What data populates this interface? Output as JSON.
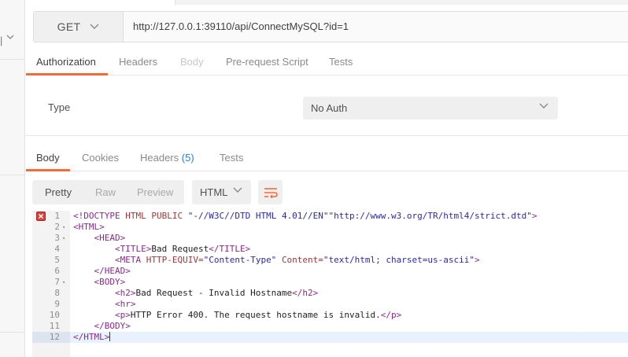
{
  "request": {
    "method": "GET",
    "url": "http://127.0.0.1:39110/api/ConnectMySQL?id=1",
    "tabs": [
      {
        "label": "Authorization",
        "state": "active"
      },
      {
        "label": "Headers",
        "state": "normal"
      },
      {
        "label": "Body",
        "state": "disabled"
      },
      {
        "label": "Pre-request Script",
        "state": "normal"
      },
      {
        "label": "Tests",
        "state": "normal"
      }
    ]
  },
  "auth": {
    "type_label": "Type",
    "type_value": "No Auth"
  },
  "response": {
    "tabs": {
      "body": "Body",
      "cookies": "Cookies",
      "headers": "Headers",
      "headers_count": "(5)",
      "tests": "Tests"
    },
    "view_modes": [
      "Pretty",
      "Raw",
      "Preview"
    ],
    "active_view": "Pretty",
    "language": "HTML",
    "wrap_icon": "wrap-lines-icon",
    "code_lines": [
      {
        "n": "1",
        "text": "<!DOCTYPE HTML PUBLIC \"-//W3C//DTD HTML 4.01//EN\"\"http://www.w3.org/TR/html4/strict.dtd\">",
        "error": true
      },
      {
        "n": "2",
        "text": "<HTML>",
        "fold": true
      },
      {
        "n": "3",
        "text": "    <HEAD>",
        "fold": true
      },
      {
        "n": "4",
        "text": "        <TITLE>Bad Request</TITLE>"
      },
      {
        "n": "5",
        "text": "        <META HTTP-EQUIV=\"Content-Type\" Content=\"text/html; charset=us-ascii\">"
      },
      {
        "n": "6",
        "text": "    </HEAD>"
      },
      {
        "n": "7",
        "text": "    <BODY>",
        "fold": true
      },
      {
        "n": "8",
        "text": "        <h2>Bad Request - Invalid Hostname</h2>"
      },
      {
        "n": "9",
        "text": "        <hr>"
      },
      {
        "n": "10",
        "text": "        <p>HTTP Error 400. The request hostname is invalid.</p>"
      },
      {
        "n": "11",
        "text": "    </BODY>"
      },
      {
        "n": "12",
        "text": "</HTML>",
        "active": true
      }
    ]
  },
  "colors": {
    "accent": "#f26b3a",
    "link": "#2f7ed8",
    "error": "#d9413a"
  }
}
